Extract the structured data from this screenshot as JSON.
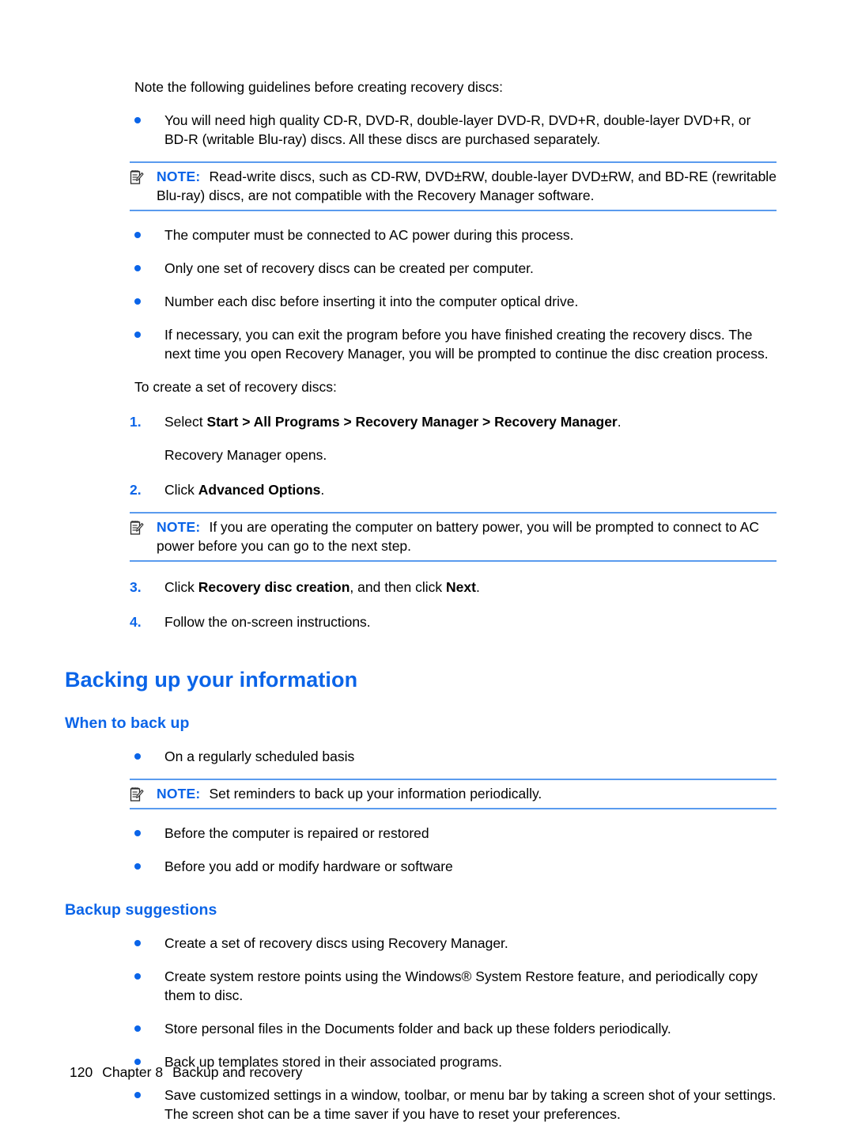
{
  "document": {
    "intro": "Note the following guidelines before creating recovery discs:",
    "guidelines_bullets": [
      "You will need high quality CD-R, DVD-R, double-layer DVD-R, DVD+R, double-layer DVD+R, or BD-R (writable Blu-ray) discs. All these discs are purchased separately."
    ],
    "note1": {
      "label": "NOTE:",
      "text": "Read-write discs, such as CD-RW, DVD±RW, double-layer DVD±RW, and BD-RE (rewritable Blu-ray) discs, are not compatible with the Recovery Manager software.",
      "icon": "note-pad-pencil-icon"
    },
    "guidelines_bullets2": [
      "The computer must be connected to AC power during this process.",
      "Only one set of recovery discs can be created per computer.",
      "Number each disc before inserting it into the computer optical drive.",
      "If necessary, you can exit the program before you have finished creating the recovery discs. The next time you open Recovery Manager, you will be prompted to continue the disc creation process."
    ],
    "create_intro": "To create a set of recovery discs:",
    "steps": [
      {
        "number": "1.",
        "prefix": "Select ",
        "bold": "Start > All Programs > Recovery Manager > Recovery Manager",
        "suffix": ".",
        "sub": "Recovery Manager opens."
      },
      {
        "number": "2.",
        "prefix": "Click ",
        "bold": "Advanced Options",
        "suffix": ".",
        "sub": ""
      },
      {
        "number": "3.",
        "prefix": "Click ",
        "bold": "Recovery disc creation",
        "middle": ", and then click ",
        "bold2": "Next",
        "suffix": ".",
        "sub": ""
      },
      {
        "number": "4.",
        "prefix": "Follow the on-screen instructions.",
        "bold": "",
        "suffix": "",
        "sub": ""
      }
    ],
    "note2": {
      "label": "NOTE:",
      "text": "If you are operating the computer on battery power, you will be prompted to connect to AC power before you can go to the next step.",
      "icon": "note-pad-pencil-icon"
    },
    "heading1": "Backing up your information",
    "heading2a": "When to back up",
    "when_bullets_before": [
      "On a regularly scheduled basis"
    ],
    "note3": {
      "label": "NOTE:",
      "text": "Set reminders to back up your information periodically.",
      "icon": "note-pad-pencil-icon"
    },
    "when_bullets_after": [
      "Before the computer is repaired or restored",
      "Before you add or modify hardware or software"
    ],
    "heading2b": "Backup suggestions",
    "suggestion_bullets": [
      "Create a set of recovery discs using Recovery Manager.",
      "Create system restore points using the Windows® System Restore feature, and periodically copy them to disc.",
      "Store personal files in the Documents folder and back up these folders periodically.",
      "Back up templates stored in their associated programs.",
      "Save customized settings in a window, toolbar, or menu bar by taking a screen shot of your settings. The screen shot can be a time saver if you have to reset your preferences."
    ],
    "footer": {
      "page_number": "120",
      "chapter": "Chapter 8",
      "chapter_title": "Backup and recovery"
    },
    "colors": {
      "accent_blue": "#0a64e8",
      "rule_blue": "#5a9bee",
      "text_black": "#000000"
    }
  }
}
